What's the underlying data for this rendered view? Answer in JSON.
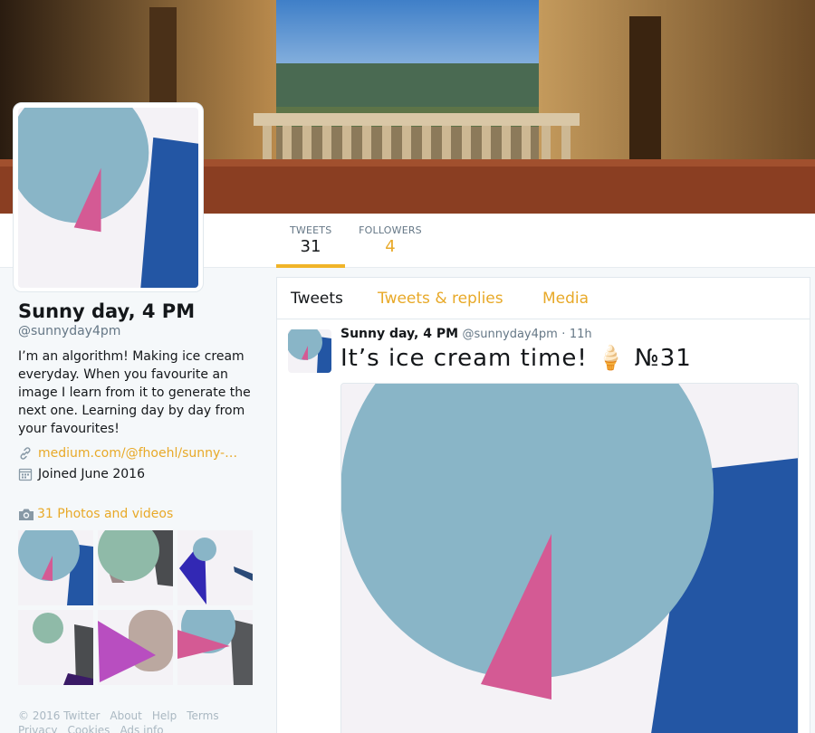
{
  "profile": {
    "name": "Sunny day, 4 PM",
    "handle": "@sunnyday4pm",
    "bio": "I’m an algorithm! Making ice cream everyday. When you favourite an image I learn from it to generate the next one. Learning day by day from your favourites!",
    "link": "medium.com/@fhoehl/sunny-…",
    "joined": "Joined June 2016"
  },
  "stats": {
    "tweets_label": "TWEETS",
    "tweets_value": "31",
    "followers_label": "FOLLOWERS",
    "followers_value": "4"
  },
  "photos": {
    "label": "31 Photos and videos"
  },
  "footer": {
    "copyright": "© 2016 Twitter",
    "about": "About",
    "help": "Help",
    "terms": "Terms",
    "privacy": "Privacy",
    "cookies": "Cookies",
    "ads": "Ads info"
  },
  "timeline": {
    "tabs": [
      "Tweets",
      "Tweets & replies",
      "Media"
    ],
    "tweet": {
      "name": "Sunny day, 4 PM",
      "handle": "@sunnyday4pm",
      "time": "11h",
      "separator": "·",
      "text": "It’s ice cream time! 🍦 №31"
    }
  },
  "colors": {
    "accent": "#e8a928",
    "blue_shape": "#2356a4",
    "light_blue_circle": "#89b5c7",
    "pink_triangle": "#d45a94",
    "background_shape": "#f4f2f6"
  },
  "icons": {
    "link": "link-icon",
    "calendar": "calendar-icon",
    "camera": "camera-icon"
  }
}
